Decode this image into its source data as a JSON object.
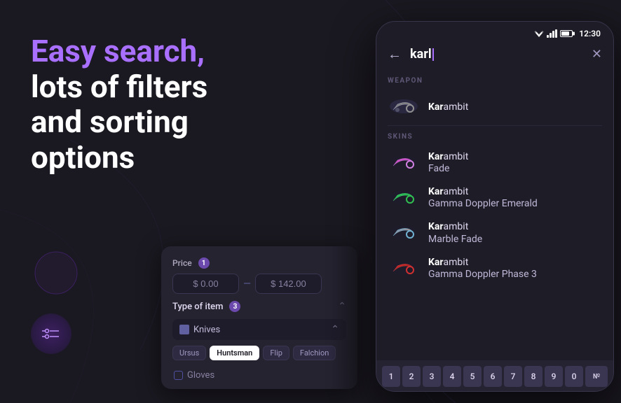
{
  "background_color": "#1a1820",
  "left": {
    "headline_part1": "Easy search,",
    "headline_highlight": "Easy search,",
    "headline_plain": "Easy search,",
    "headline_line2": "lots of filters",
    "headline_line3": "and sorting",
    "headline_line4": "options"
  },
  "filter_card": {
    "price_label": "Price",
    "price_badge": "1",
    "price_min": "$ 0.00",
    "price_max": "$ 142.00",
    "type_label": "Type of item",
    "type_badge": "3",
    "knives_label": "Knives",
    "tags": [
      "Ursus",
      "Huntsman",
      "Flip",
      "Falchion"
    ],
    "active_tag": "Huntsman",
    "gloves_label": "Gloves"
  },
  "phone": {
    "status_time": "12:30",
    "search_query_highlight": "Kar",
    "search_query_normal": "ambit",
    "search_typed": "karl",
    "sections": [
      {
        "label": "WEAPON",
        "items": [
          {
            "name_highlight": "Kar",
            "name_normal": "ambit",
            "sub": "",
            "color": "#8080c0"
          }
        ]
      },
      {
        "label": "SKINS",
        "items": [
          {
            "name_highlight": "Kar",
            "name_normal": "ambit",
            "sub": "Fade",
            "color1": "#e060b0",
            "color2": "#a030e0"
          },
          {
            "name_highlight": "Kar",
            "name_normal": "ambit",
            "sub": "Gamma Doppler Emerald",
            "color1": "#30d060",
            "color2": "#208040"
          },
          {
            "name_highlight": "Kar",
            "name_normal": "ambit",
            "sub": "Marble Fade",
            "color1": "#60b0e0",
            "color2": "#e06030"
          },
          {
            "name_highlight": "Kar",
            "name_normal": "ambit",
            "sub": "Gamma Doppler Phase 3",
            "color1": "#e03030",
            "color2": "#801010"
          }
        ]
      }
    ],
    "keyboard_keys": [
      "1",
      "2",
      "3",
      "4",
      "5",
      "6",
      "7",
      "8",
      "9",
      "0",
      "№"
    ]
  }
}
